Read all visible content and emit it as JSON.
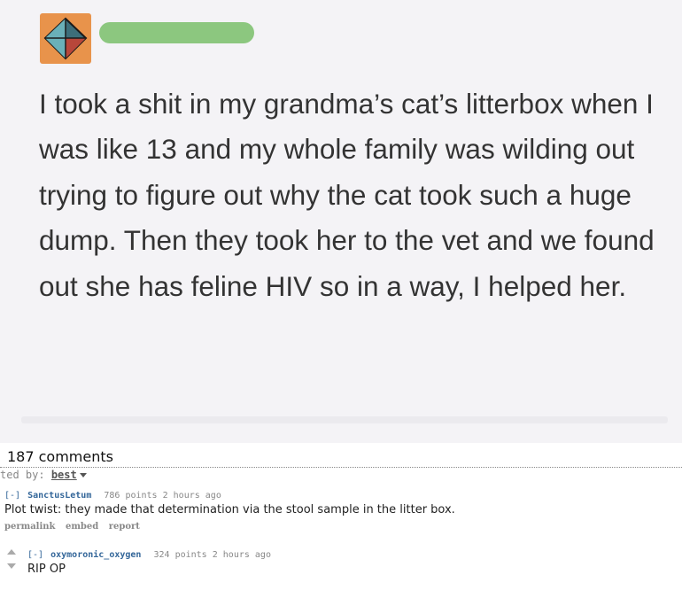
{
  "post": {
    "text": "I took a shit in my grandma’s cat’s litterbox when I was like 13 and my whole family was wilding out trying to figure out why the cat took such a huge dump. Then they took her to the vet and we found out she has feline HIV so in a way, I helped her."
  },
  "comments_section": {
    "count_label": "187 comments",
    "sort_prefix": "ted by:",
    "sort_value": "best"
  },
  "comments": [
    {
      "toggle": "[-]",
      "author": "SanctusLetum",
      "points": "786 points",
      "time": "2 hours ago",
      "body": "Plot twist: they made that determination via the stool sample in the litter box.",
      "buttons": [
        "permalink",
        "embed",
        "report"
      ]
    },
    {
      "toggle": "[-]",
      "author": "oxymoronic_oxygen",
      "points": "324 points",
      "time": "2 hours ago",
      "body": "RIP OP"
    }
  ],
  "colors": {
    "avatar": "#e8934b",
    "redaction": "#8cc77f",
    "username": "#336699"
  },
  "icons": [
    "upvote-arrow-icon",
    "downvote-arrow-icon",
    "dropdown-caret-icon"
  ]
}
